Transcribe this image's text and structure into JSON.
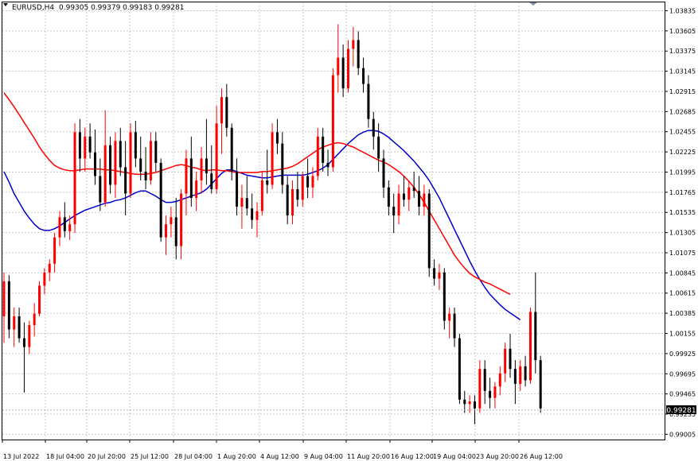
{
  "header": {
    "symbol_label": "EURUSD,H4",
    "ohlc_label": "0.99305 0.99379 0.99183 0.99281"
  },
  "colors": {
    "up": "#ff0000",
    "down": "#000000",
    "ma_fast": "#0000cc",
    "ma_slow": "#ff0000",
    "grid": "#c8c8c8",
    "price_tag_bg": "#000000",
    "price_tag_text": "#ffffff"
  },
  "chart_data": {
    "type": "candlestick",
    "y_ticks": [
      "1.03835",
      "1.03605",
      "1.03375",
      "1.03145",
      "1.02915",
      "1.02685",
      "1.02455",
      "1.02225",
      "1.01995",
      "1.01765",
      "1.01535",
      "1.01305",
      "1.01075",
      "1.00845",
      "1.00615",
      "1.00385",
      "1.00155",
      "0.99925",
      "0.99695",
      "0.99465",
      "0.99235",
      "0.99005"
    ],
    "x_labels": [
      "13 Jul 2022",
      "18 Jul 04:00",
      "20 Jul 20:00",
      "25 Jul 12:00",
      "28 Jul 04:00",
      "1 Aug 20:00",
      "4 Aug 12:00",
      "9 Aug 04:00",
      "11 Aug 20:00",
      "16 Aug 12:00",
      "19 Aug 04:00",
      "23 Aug 20:00",
      "26 Aug 12:00"
    ],
    "ylim": [
      0.98945,
      1.0393
    ],
    "current_price": "0.99281",
    "grid": true,
    "candles": [
      [
        1.0035,
        1.0085,
        1.0005,
        1.0075
      ],
      [
        1.0075,
        1.0082,
        1.001,
        1.002
      ],
      [
        1.002,
        1.0045,
        1.0,
        1.0035
      ],
      [
        1.0035,
        1.0045,
        1.0005,
        1.001
      ],
      [
        1.001,
        1.0028,
        0.9948,
        1.0
      ],
      [
        1.0,
        1.003,
        0.9992,
        1.0025
      ],
      [
        1.0025,
        1.005,
        1.0012,
        1.0038
      ],
      [
        1.0038,
        1.0075,
        1.0035,
        1.007
      ],
      [
        1.007,
        1.009,
        1.006,
        1.0085
      ],
      [
        1.0085,
        1.01,
        1.0075,
        1.0095
      ],
      [
        1.0095,
        1.013,
        1.0085,
        1.0125
      ],
      [
        1.0125,
        1.0155,
        1.0115,
        1.0148
      ],
      [
        1.0148,
        1.0165,
        1.0125,
        1.0132
      ],
      [
        1.0132,
        1.015,
        1.0122,
        1.014
      ],
      [
        1.014,
        1.0255,
        1.013,
        1.0245
      ],
      [
        1.0245,
        1.026,
        1.02,
        1.0215
      ],
      [
        1.0215,
        1.025,
        1.02,
        1.024
      ],
      [
        1.024,
        1.0255,
        1.0215,
        1.0222
      ],
      [
        1.0222,
        1.0248,
        1.0185,
        1.0195
      ],
      [
        1.0195,
        1.0215,
        1.0155,
        1.0165
      ],
      [
        1.0165,
        1.027,
        1.016,
        1.023
      ],
      [
        1.023,
        1.024,
        1.0175,
        1.0185
      ],
      [
        1.0185,
        1.0245,
        1.017,
        1.0235
      ],
      [
        1.0235,
        1.025,
        1.0195,
        1.0205
      ],
      [
        1.0205,
        1.0235,
        1.015,
        1.0175
      ],
      [
        1.0175,
        1.0255,
        1.017,
        1.0245
      ],
      [
        1.0245,
        1.0258,
        1.0205,
        1.0215
      ],
      [
        1.0215,
        1.024,
        1.019,
        1.02
      ],
      [
        1.02,
        1.0228,
        1.018,
        1.019
      ],
      [
        1.019,
        1.0245,
        1.0185,
        1.0235
      ],
      [
        1.0235,
        1.0245,
        1.02,
        1.021
      ],
      [
        1.021,
        1.0215,
        1.012,
        1.0125
      ],
      [
        1.0125,
        1.015,
        1.0105,
        1.014
      ],
      [
        1.014,
        1.016,
        1.0125,
        1.0148
      ],
      [
        1.0148,
        1.017,
        1.01,
        1.0115
      ],
      [
        1.0115,
        1.018,
        1.01,
        1.0175
      ],
      [
        1.0175,
        1.0225,
        1.015,
        1.0215
      ],
      [
        1.0215,
        1.024,
        1.016,
        1.017
      ],
      [
        1.017,
        1.02,
        1.0155,
        1.019
      ],
      [
        1.019,
        1.0228,
        1.0175,
        1.0215
      ],
      [
        1.0215,
        1.026,
        1.0185,
        1.0198
      ],
      [
        1.0198,
        1.023,
        1.0175,
        1.018
      ],
      [
        1.018,
        1.0275,
        1.0175,
        1.0255
      ],
      [
        1.0255,
        1.0295,
        1.022,
        1.0285
      ],
      [
        1.0285,
        1.03,
        1.024,
        1.025
      ],
      [
        1.025,
        1.0255,
        1.019,
        1.02
      ],
      [
        1.02,
        1.0215,
        1.015,
        1.016
      ],
      [
        1.016,
        1.0185,
        1.0135,
        1.017
      ],
      [
        1.017,
        1.0195,
        1.015,
        1.0158
      ],
      [
        1.0158,
        1.0175,
        1.0135,
        1.0145
      ],
      [
        1.0145,
        1.0165,
        1.0125,
        1.0155
      ],
      [
        1.0155,
        1.02,
        1.015,
        1.019
      ],
      [
        1.019,
        1.0225,
        1.0175,
        1.0185
      ],
      [
        1.0185,
        1.0255,
        1.018,
        1.0245
      ],
      [
        1.0245,
        1.026,
        1.022,
        1.0232
      ],
      [
        1.0232,
        1.0245,
        1.0175,
        1.0185
      ],
      [
        1.0185,
        1.0195,
        1.014,
        1.015
      ],
      [
        1.015,
        1.019,
        1.014,
        1.018
      ],
      [
        1.018,
        1.02,
        1.016,
        1.0168
      ],
      [
        1.0168,
        1.02,
        1.016,
        1.0195
      ],
      [
        1.0195,
        1.0215,
        1.017,
        1.0182
      ],
      [
        1.0182,
        1.0205,
        1.017,
        1.0195
      ],
      [
        1.0195,
        1.025,
        1.019,
        1.024
      ],
      [
        1.024,
        1.025,
        1.02,
        1.021
      ],
      [
        1.021,
        1.0225,
        1.0195,
        1.0205
      ],
      [
        1.0205,
        1.0318,
        1.02,
        1.031
      ],
      [
        1.031,
        1.0368,
        1.029,
        1.033
      ],
      [
        1.033,
        1.0345,
        1.0285,
        1.0295
      ],
      [
        1.0295,
        1.035,
        1.029,
        1.034
      ],
      [
        1.034,
        1.0365,
        1.032,
        1.035
      ],
      [
        1.035,
        1.036,
        1.031,
        1.0318
      ],
      [
        1.0318,
        1.033,
        1.029,
        1.03
      ],
      [
        1.03,
        1.031,
        1.025,
        1.026
      ],
      [
        1.026,
        1.0268,
        1.0225,
        1.024
      ],
      [
        1.024,
        1.0255,
        1.02,
        1.0215
      ],
      [
        1.0215,
        1.0225,
        1.017,
        1.0182
      ],
      [
        1.0182,
        1.019,
        1.015,
        1.016
      ],
      [
        1.016,
        1.0175,
        1.013,
        1.015
      ],
      [
        1.015,
        1.0185,
        1.014,
        1.0175
      ],
      [
        1.0175,
        1.0195,
        1.016,
        1.0168
      ],
      [
        1.0168,
        1.019,
        1.0155,
        1.0182
      ],
      [
        1.0182,
        1.02,
        1.017,
        1.0178
      ],
      [
        1.0178,
        1.0195,
        1.015,
        1.016
      ],
      [
        1.016,
        1.0185,
        1.015,
        1.0175
      ],
      [
        1.0175,
        1.018,
        1.008,
        1.009
      ],
      [
        1.009,
        1.01,
        1.007,
        1.0078
      ],
      [
        1.0078,
        1.0095,
        1.0065,
        1.0085
      ],
      [
        1.0085,
        1.009,
        1.002,
        1.003
      ],
      [
        1.003,
        1.0045,
        1.001,
        1.0038
      ],
      [
        1.0038,
        1.0045,
        1.0,
        1.001
      ],
      [
        1.001,
        1.0015,
        0.9935,
        0.994
      ],
      [
        0.994,
        0.995,
        0.9925,
        0.9935
      ],
      [
        0.9935,
        0.9945,
        0.9925,
        0.9938
      ],
      [
        0.9938,
        0.9945,
        0.9912,
        0.993
      ],
      [
        0.993,
        0.9985,
        0.9925,
        0.9975
      ],
      [
        0.9975,
        0.9985,
        0.9935,
        0.995
      ],
      [
        0.995,
        0.9965,
        0.993,
        0.9942
      ],
      [
        0.9942,
        0.996,
        0.993,
        0.9955
      ],
      [
        0.9955,
        0.9978,
        0.9945,
        0.997
      ],
      [
        0.997,
        1.0005,
        0.996,
        0.9998
      ],
      [
        0.9998,
        1.0015,
        0.9965,
        0.9975
      ],
      [
        0.9975,
        0.9985,
        0.9935,
        0.9958
      ],
      [
        0.9958,
        0.9985,
        0.995,
        0.9978
      ],
      [
        0.9978,
        0.999,
        0.9955,
        0.9962
      ],
      [
        0.9962,
        1.0045,
        0.9958,
        1.004
      ],
      [
        1.004,
        1.0085,
        0.997,
        0.9985
      ],
      [
        0.9985,
        0.999,
        0.9925,
        0.993
      ]
    ],
    "series": [
      {
        "color": "#0000cc",
        "values": [
          1.02,
          1.0188,
          1.0175,
          1.0165,
          1.0155,
          1.0147,
          1.014,
          1.0135,
          1.0133,
          1.0133,
          1.0135,
          1.0138,
          1.0142,
          1.0146,
          1.015,
          1.0153,
          1.0156,
          1.0158,
          1.016,
          1.0162,
          1.0164,
          1.0165,
          1.0167,
          1.0168,
          1.017,
          1.0173,
          1.0176,
          1.0178,
          1.0178,
          1.0175,
          1.0172,
          1.0168,
          1.0165,
          1.0165,
          1.0166,
          1.0168,
          1.017,
          1.0172,
          1.0174,
          1.0176,
          1.018,
          1.0186,
          1.0192,
          1.0198,
          1.0202,
          1.0202,
          1.02,
          1.0198,
          1.0196,
          1.0195,
          1.0194,
          1.0193,
          1.0193,
          1.0194,
          1.0195,
          1.0196,
          1.0196,
          1.0196,
          1.0196,
          1.0196,
          1.0197,
          1.0199,
          1.0201,
          1.0204,
          1.0208,
          1.0214,
          1.022,
          1.0226,
          1.0232,
          1.0237,
          1.0242,
          1.0245,
          1.0247,
          1.0247,
          1.0246,
          1.0243,
          1.0239,
          1.0234,
          1.0229,
          1.0224,
          1.0218,
          1.0212,
          1.0205,
          1.0198,
          1.019,
          1.018,
          1.017,
          1.0158,
          1.0146,
          1.0134,
          1.0122,
          1.011,
          1.0098,
          1.0087,
          1.0077,
          1.0068,
          1.006,
          1.0054,
          1.0048,
          1.0043,
          1.0039,
          1.0035,
          1.0031
        ]
      },
      {
        "color": "#ff0000",
        "values": [
          1.029,
          1.0282,
          1.0274,
          1.0265,
          1.0256,
          1.0247,
          1.0238,
          1.0228,
          1.022,
          1.0213,
          1.0207,
          1.0204,
          1.0202,
          1.0201,
          1.0201,
          1.0202,
          1.0203,
          1.0203,
          1.0203,
          1.0203,
          1.0202,
          1.0202,
          1.0201,
          1.02,
          1.0199,
          1.0198,
          1.0197,
          1.0197,
          1.0197,
          1.0198,
          1.0199,
          1.0201,
          1.0203,
          1.0205,
          1.0207,
          1.0208,
          1.0207,
          1.0205,
          1.0204,
          1.0202,
          1.0201,
          1.0202,
          1.0202,
          1.0201,
          1.0201,
          1.02,
          1.0199,
          1.0199,
          1.0199,
          1.0199,
          1.0199,
          1.02,
          1.02,
          1.0201,
          1.0202,
          1.0203,
          1.0204,
          1.0206,
          1.0209,
          1.0213,
          1.0217,
          1.0221,
          1.0225,
          1.0228,
          1.023,
          1.0232,
          1.0233,
          1.0232,
          1.023,
          1.0228,
          1.0225,
          1.0222,
          1.0219,
          1.0216,
          1.0213,
          1.0211,
          1.0208,
          1.0204,
          1.02,
          1.0195,
          1.0189,
          1.0182,
          1.0174,
          1.0165,
          1.0155,
          1.0145,
          1.0135,
          1.0125,
          1.0115,
          1.0105,
          1.0097,
          1.009,
          1.0084,
          1.008,
          1.0077,
          1.0074,
          1.0072,
          1.0069,
          1.0066,
          1.0063,
          1.006
        ]
      }
    ]
  }
}
